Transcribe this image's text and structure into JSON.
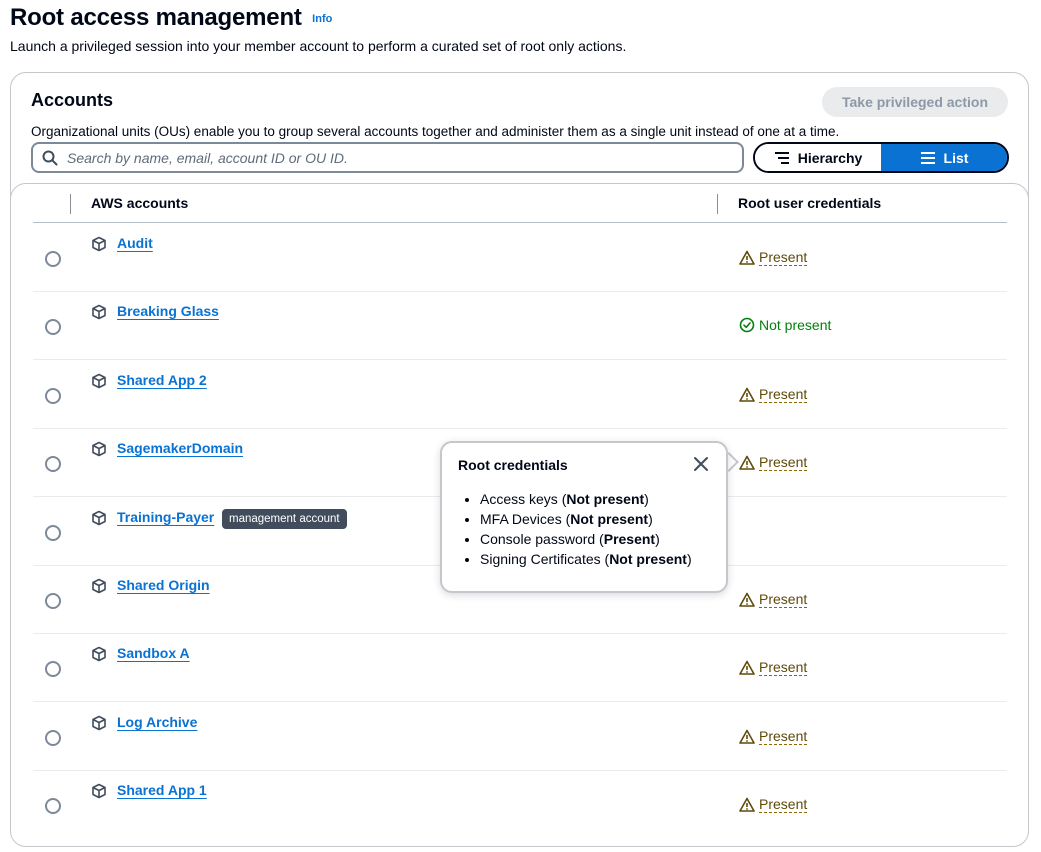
{
  "page": {
    "title": "Root access management",
    "info": "Info",
    "description": "Launch a privileged session into your member account to perform a curated set of root only actions."
  },
  "accounts": {
    "header": "Accounts",
    "description": "Organizational units (OUs) enable you to group several accounts together and administer them as a single unit instead of one at a time.",
    "take_action_label": "Take privileged action",
    "search_placeholder": "Search by name, email, account ID or OU ID.",
    "view_toggle": {
      "hierarchy": "Hierarchy",
      "list": "List",
      "selected": "List"
    }
  },
  "table": {
    "col_accounts": "AWS accounts",
    "col_credentials": "Root user credentials",
    "rows": [
      {
        "name": "Audit",
        "status": "Present",
        "status_type": "warning"
      },
      {
        "name": "Breaking Glass",
        "status": "Not present",
        "status_type": "success"
      },
      {
        "name": "Shared App 2",
        "status": "Present",
        "status_type": "warning"
      },
      {
        "name": "SagemakerDomain",
        "status": "Present",
        "status_type": "warning"
      },
      {
        "name": "Training-Payer",
        "badge": "management account",
        "status": "",
        "status_type": "none"
      },
      {
        "name": "Shared Origin",
        "status": "Present",
        "status_type": "warning"
      },
      {
        "name": "Sandbox A",
        "status": "Present",
        "status_type": "warning"
      },
      {
        "name": "Log Archive",
        "status": "Present",
        "status_type": "warning"
      },
      {
        "name": "Shared App 1",
        "status": "Present",
        "status_type": "warning"
      }
    ]
  },
  "popover": {
    "title": "Root credentials",
    "items": [
      {
        "label": "Access keys",
        "value": "Not present"
      },
      {
        "label": "MFA Devices",
        "value": "Not present"
      },
      {
        "label": "Console password",
        "value": "Present"
      },
      {
        "label": "Signing Certificates",
        "value": "Not present"
      }
    ]
  },
  "colors": {
    "link": "#0972d3",
    "warning": "#8d6605",
    "success": "#037f0c",
    "badge": "#414d5c"
  },
  "icons": {
    "account": "cube-icon",
    "warning": "warning-triangle-icon",
    "success": "check-circle-icon",
    "search": "search-icon",
    "close": "close-icon"
  }
}
